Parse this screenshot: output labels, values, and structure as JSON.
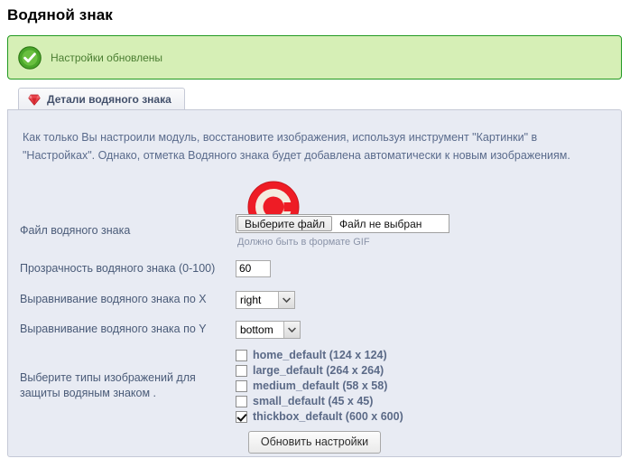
{
  "page": {
    "title": "Водяной знак"
  },
  "notice": {
    "icon": "success-check-icon",
    "text": "Настройки обновлены"
  },
  "tab": {
    "icon": "gem-icon",
    "label": "Детали водяного знака"
  },
  "panel": {
    "description": "Как только Вы настроили модуль, восстановите изображения, используя инструмент \"Картинки\" в \"Настройках\". Однако, отметка Водяного знака будет добавлена автоматически к новым изображениям.",
    "preview_icon": "watermark-copyright-preview"
  },
  "form": {
    "file_row": {
      "label": "Файл водяного знака",
      "button_label": "Выберите файл",
      "file_name": "Файл не выбран",
      "hint": "Должно быть в формате GIF"
    },
    "opacity_row": {
      "label": "Прозрачность водяного знака (0-100)",
      "value": "60"
    },
    "align_x_row": {
      "label": "Выравнивание водяного знака по X",
      "value": "right"
    },
    "align_y_row": {
      "label": "Выравнивание водяного знака по Y",
      "value": "bottom"
    },
    "types_row": {
      "label": "Выберите типы изображений для защиты водяным знаком .",
      "items": [
        {
          "label": "home_default (124 x 124)",
          "checked": false
        },
        {
          "label": "large_default (264 x 264)",
          "checked": false
        },
        {
          "label": "medium_default (58 x 58)",
          "checked": false
        },
        {
          "label": "small_default (45 x 45)",
          "checked": false
        },
        {
          "label": "thickbox_default (600 x 600)",
          "checked": true
        }
      ]
    },
    "submit_label": "Обновить настройки"
  },
  "colors": {
    "notice_bg": "#d6efb6",
    "notice_border": "#229922",
    "notice_text": "#4a7d31",
    "panel_bg": "#e8ebf3",
    "panel_border": "#c5c9d6",
    "label_text": "#4a5b78",
    "watermark_red": "#ee1c25"
  }
}
